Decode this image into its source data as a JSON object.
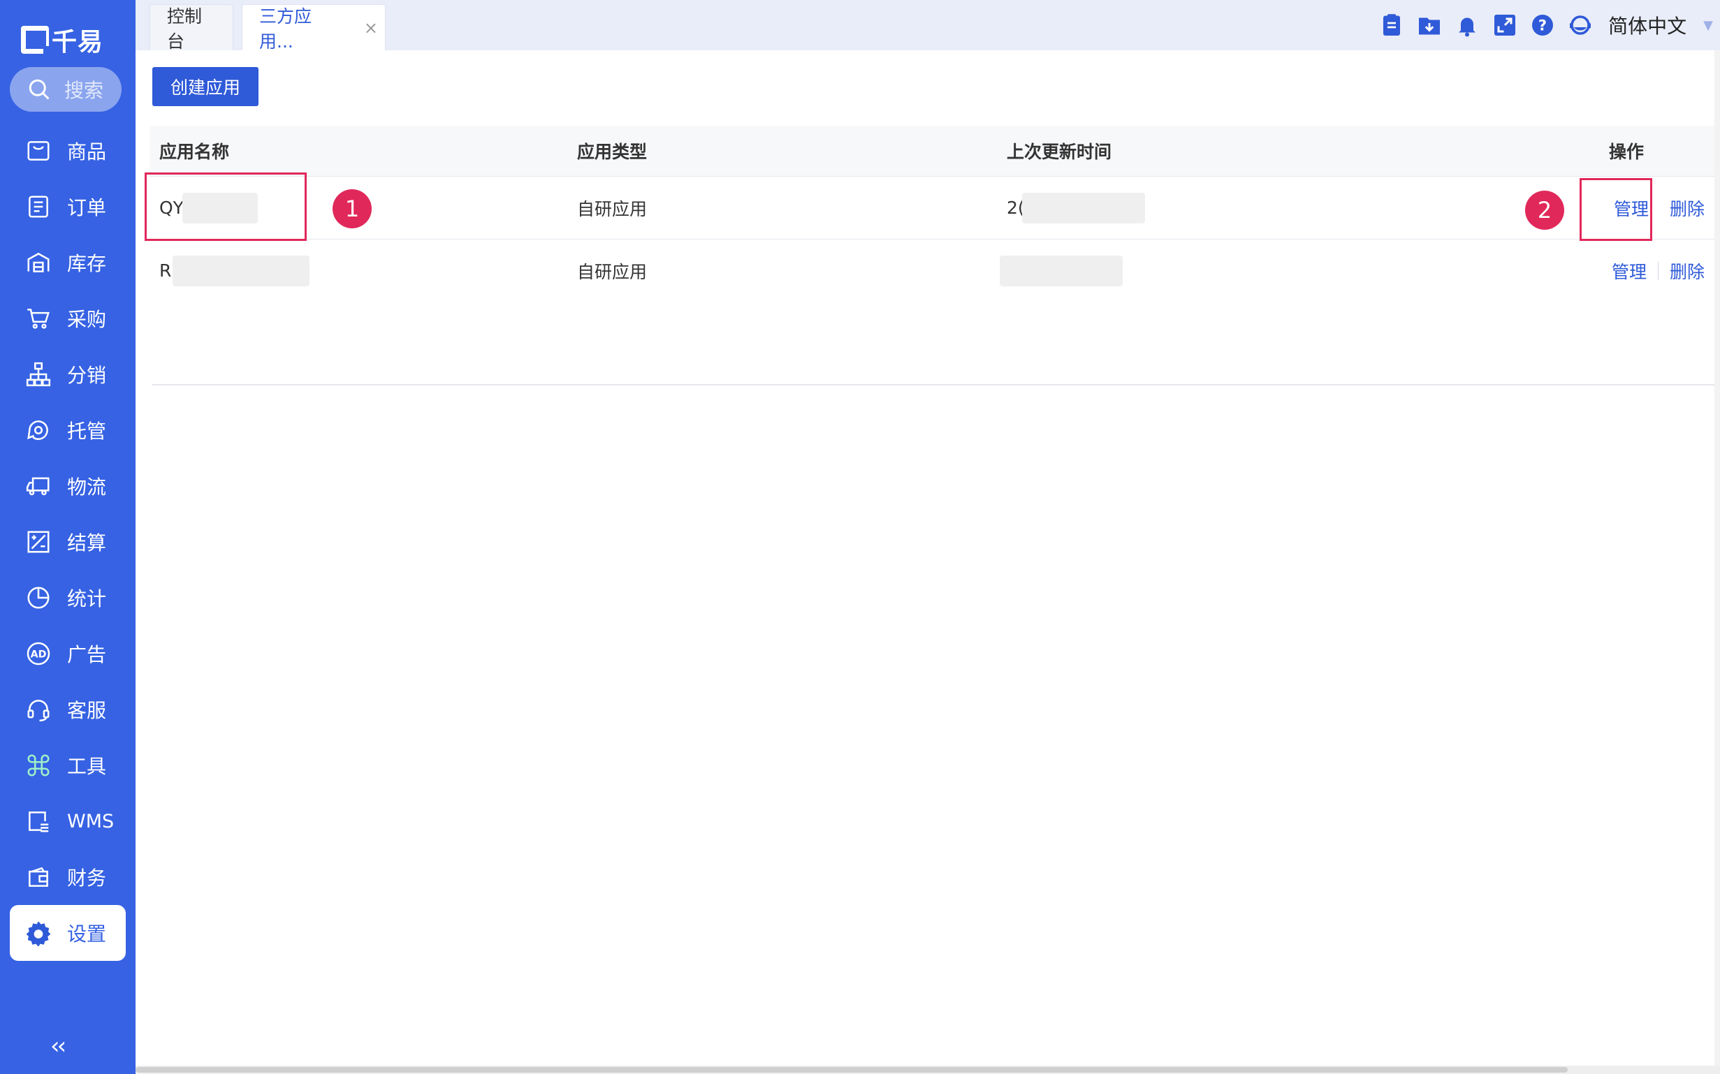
{
  "sidebar": {
    "logo_text": "千易",
    "search_label": "搜索",
    "items": [
      {
        "label": "商品",
        "icon": "bag-icon"
      },
      {
        "label": "订单",
        "icon": "document-icon"
      },
      {
        "label": "库存",
        "icon": "warehouse-icon"
      },
      {
        "label": "采购",
        "icon": "cart-icon"
      },
      {
        "label": "分销",
        "icon": "hierarchy-icon"
      },
      {
        "label": "托管",
        "icon": "hosting-icon"
      },
      {
        "label": "物流",
        "icon": "truck-icon"
      },
      {
        "label": "结算",
        "icon": "settlement-icon"
      },
      {
        "label": "统计",
        "icon": "pie-chart-icon"
      },
      {
        "label": "广告",
        "icon": "ad-icon"
      },
      {
        "label": "客服",
        "icon": "headset-icon"
      },
      {
        "label": "工具",
        "icon": "command-icon"
      },
      {
        "label": "WMS",
        "icon": "wms-icon"
      },
      {
        "label": "财务",
        "icon": "wallet-icon"
      },
      {
        "label": "设置",
        "icon": "gear-icon",
        "active": true
      }
    ],
    "collapse_glyph": "‹‹"
  },
  "tabs": [
    {
      "label": "控制台"
    },
    {
      "label": "三方应用...",
      "active": true,
      "close": "×"
    }
  ],
  "header": {
    "icons": [
      "clipboard-icon",
      "download-icon",
      "bell-icon",
      "fullscreen-icon",
      "help-icon",
      "support-icon"
    ],
    "language": "简体中文"
  },
  "toolbar": {
    "create_label": "创建应用"
  },
  "table": {
    "columns": [
      "应用名称",
      "应用类型",
      "上次更新时间",
      "操作"
    ],
    "rows": [
      {
        "name": "QY",
        "type": "自研应用",
        "updated": "2(",
        "manage": "管理",
        "delete": "删除"
      },
      {
        "name": "R",
        "type": "自研应用",
        "updated": "",
        "manage": "管理",
        "delete": "删除"
      }
    ]
  },
  "annotations": {
    "badge1": "1",
    "badge2": "2"
  },
  "colors": {
    "sidebar": "#3662e3",
    "accent": "#2f5ad8",
    "badge": "#e1285a"
  }
}
